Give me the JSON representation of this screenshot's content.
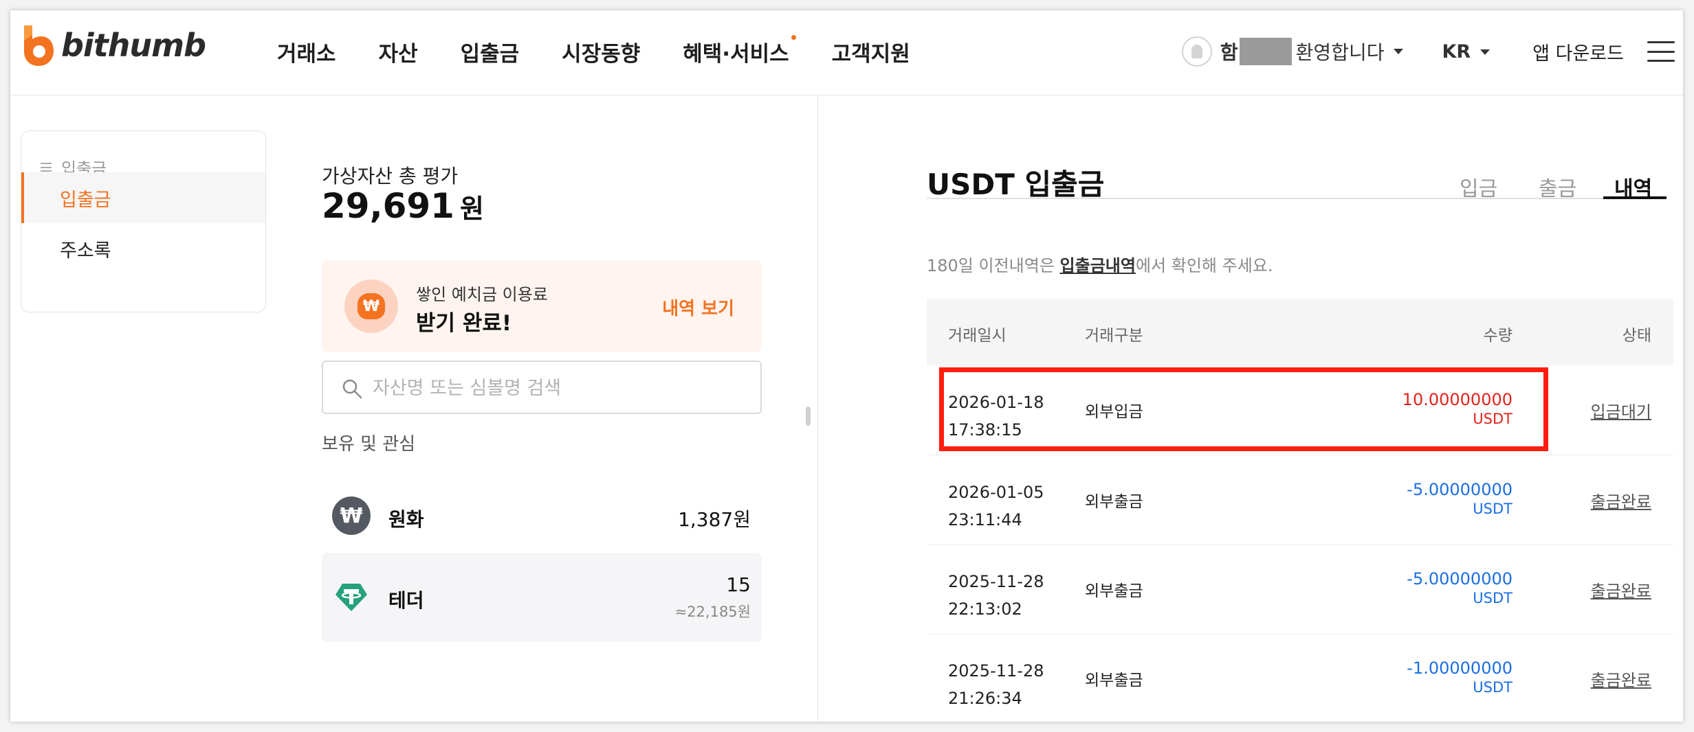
{
  "header": {
    "logo_text": "bithumb",
    "nav": [
      "거래소",
      "자산",
      "입출금",
      "시장동향",
      "혜택·서비스",
      "고객지원"
    ],
    "user_prefix": "함",
    "welcome": "환영합니다",
    "lang": "KR",
    "app_download": "앱 다운로드"
  },
  "sidebar": {
    "header": "입출금",
    "items": [
      {
        "label": "입출금",
        "active": true
      },
      {
        "label": "주소록",
        "active": false
      }
    ]
  },
  "summary": {
    "label": "가상자산 총 평가",
    "value": "29,691",
    "unit": "원"
  },
  "promo": {
    "icon": "money-bag-icon",
    "subtitle": "쌓인 예치금 이용료",
    "title": "받기 완료!",
    "link": "내역 보기",
    "icon_symbol": "₩"
  },
  "search": {
    "placeholder": "자산명 또는 심볼명 검색"
  },
  "holdings": {
    "label": "보유 및 관심",
    "assets": [
      {
        "name": "원화",
        "value": "1,387원",
        "sub": "",
        "icon_symbol": "₩"
      },
      {
        "name": "테더",
        "value": "15",
        "sub": "≈22,185원",
        "icon_symbol": "₮"
      }
    ]
  },
  "panel": {
    "title": "USDT 입출금",
    "tabs": [
      "입금",
      "출금",
      "내역"
    ],
    "active_tab": "내역",
    "notice_prefix": "180일 이전내역은 ",
    "notice_link": "입출금내역",
    "notice_suffix": "에서 확인해 주세요.",
    "columns": [
      "거래일시",
      "거래구분",
      "수량",
      "상태"
    ],
    "rows": [
      {
        "date": "2026-01-18",
        "time": "17:38:15",
        "type": "외부입금",
        "amount": "10.00000000",
        "unit": "USDT",
        "status": "입금대기",
        "color": "#e2231a"
      },
      {
        "date": "2026-01-05",
        "time": "23:11:44",
        "type": "외부출금",
        "amount": "-5.00000000",
        "unit": "USDT",
        "status": "출금완료",
        "color": "#1b6ee3"
      },
      {
        "date": "2025-11-28",
        "time": "22:13:02",
        "type": "외부출금",
        "amount": "-5.00000000",
        "unit": "USDT",
        "status": "출금완료",
        "color": "#1b6ee3"
      },
      {
        "date": "2025-11-28",
        "time": "21:26:34",
        "type": "외부출금",
        "amount": "-1.00000000",
        "unit": "USDT",
        "status": "출금완료",
        "color": "#1b6ee3"
      }
    ]
  },
  "colors": {
    "brand": "#f37321",
    "deposit": "#e2231a",
    "withdraw": "#1b6ee3",
    "highlight": "#ff1e0f"
  }
}
